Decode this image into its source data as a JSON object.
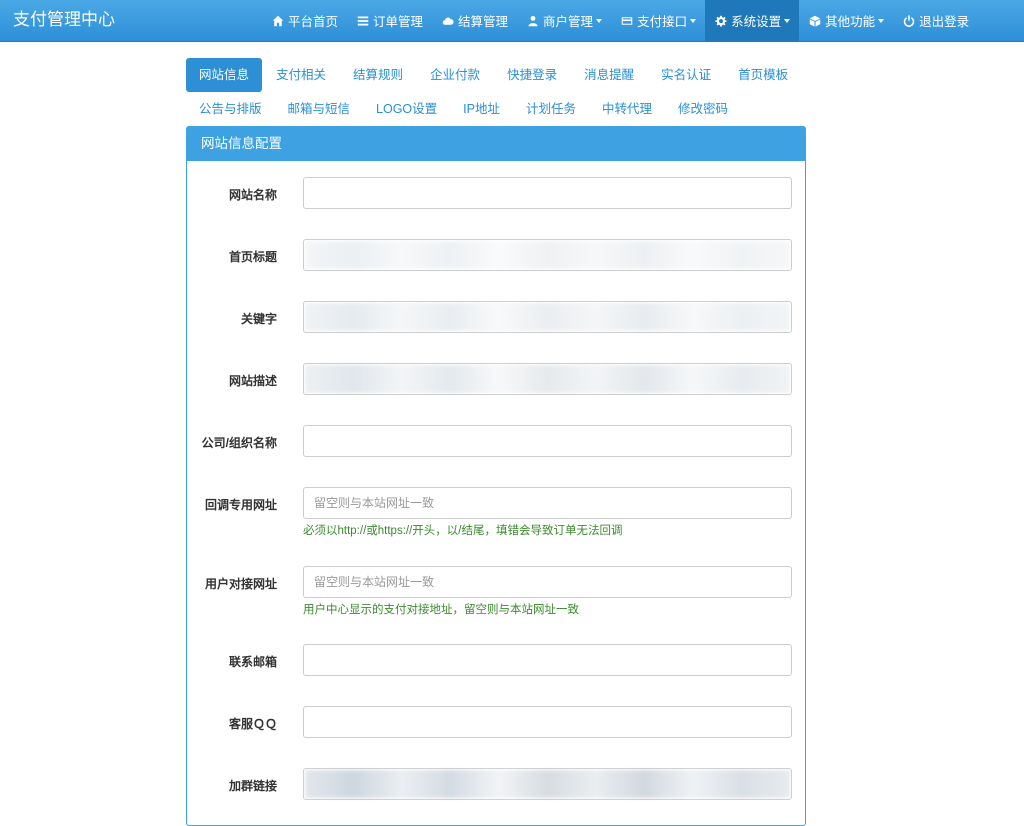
{
  "brand": "支付管理中心",
  "nav": [
    {
      "label": "平台首页",
      "icon": "home-icon",
      "dropdown": false
    },
    {
      "label": "订单管理",
      "icon": "list-icon",
      "dropdown": false
    },
    {
      "label": "结算管理",
      "icon": "cloud-icon",
      "dropdown": false
    },
    {
      "label": "商户管理",
      "icon": "user-icon",
      "dropdown": true
    },
    {
      "label": "支付接口",
      "icon": "credit-card-icon",
      "dropdown": true
    },
    {
      "label": "系统设置",
      "icon": "gear-icon",
      "dropdown": true,
      "active": true
    },
    {
      "label": "其他功能",
      "icon": "cube-icon",
      "dropdown": true
    },
    {
      "label": "退出登录",
      "icon": "power-icon",
      "dropdown": false
    }
  ],
  "tabs_row1": [
    "网站信息",
    "支付相关",
    "结算规则",
    "企业付款",
    "快捷登录",
    "消息提醒",
    "实名认证",
    "首页模板"
  ],
  "tabs_row2": [
    "公告与排版",
    "邮箱与短信",
    "LOGO设置",
    "IP地址",
    "计划任务",
    "中转代理",
    "修改密码"
  ],
  "active_tab": "网站信息",
  "panel": {
    "title": "网站信息配置",
    "fields": {
      "site_name": {
        "label": "网站名称",
        "value": ""
      },
      "home_title": {
        "label": "首页标题",
        "value": ""
      },
      "keywords": {
        "label": "关键字",
        "value": ""
      },
      "description": {
        "label": "网站描述",
        "value": ""
      },
      "company": {
        "label": "公司/组织名称",
        "value": ""
      },
      "callback_url": {
        "label": "回调专用网址",
        "value": "",
        "placeholder": "留空则与本站网址一致",
        "hint": "必须以http://或https://开头，以/结尾，填错会导致订单无法回调"
      },
      "user_api_url": {
        "label": "用户对接网址",
        "value": "",
        "placeholder": "留空则与本站网址一致",
        "hint": "用户中心显示的支付对接地址，留空则与本站网址一致"
      },
      "email": {
        "label": "联系邮箱",
        "value": ""
      },
      "qq": {
        "label": "客服ＱＱ",
        "value": ""
      },
      "group_link": {
        "label": "加群链接",
        "value": ""
      }
    }
  },
  "colors": {
    "primary": "#2d8fd6",
    "panel": "#3ea2e2",
    "hint": "#3b8a2e"
  }
}
